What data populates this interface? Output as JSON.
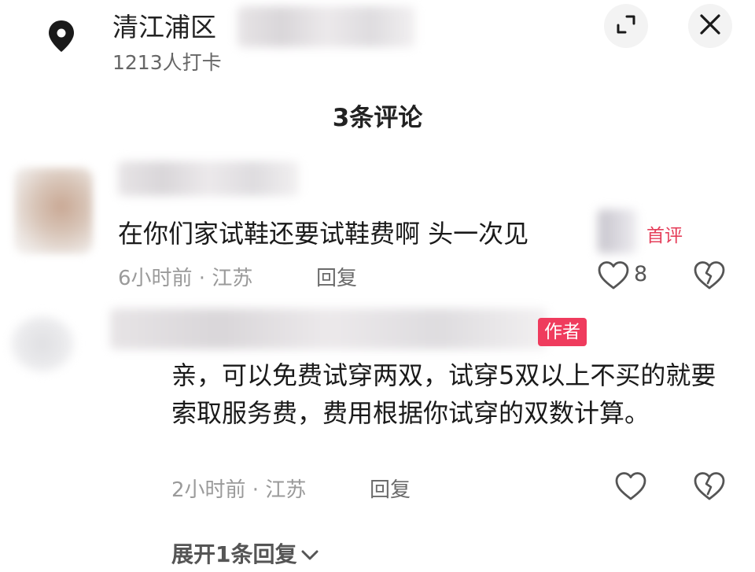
{
  "header": {
    "location_name": "清江浦区",
    "checkin_count": "1213人打卡"
  },
  "comments_title": "3条评论",
  "comments": [
    {
      "text": "在你们家试鞋还要试鞋费啊 头一次见",
      "badge": "首评",
      "time_location": "6小时前 · 江苏",
      "reply_label": "回复",
      "likes": "8"
    },
    {
      "badge": "作者",
      "text": "亲，可以免费试穿两双，试穿5双以上不买的就要索取服务费，费用根据你试穿的双数计算。",
      "time_location": "2小时前 · 江苏",
      "reply_label": "回复",
      "expand_replies": "展开1条回复"
    }
  ],
  "icons": {
    "location": "location-pin-icon",
    "expand": "expand-icon",
    "close": "close-icon",
    "like": "heart-outline-icon",
    "dislike": "broken-heart-icon",
    "chevron": "chevron-down-icon"
  },
  "colors": {
    "accent_red": "#ef3b5d",
    "first_comment_red": "#e53e5a",
    "meta_gray": "#9a9a9a"
  }
}
